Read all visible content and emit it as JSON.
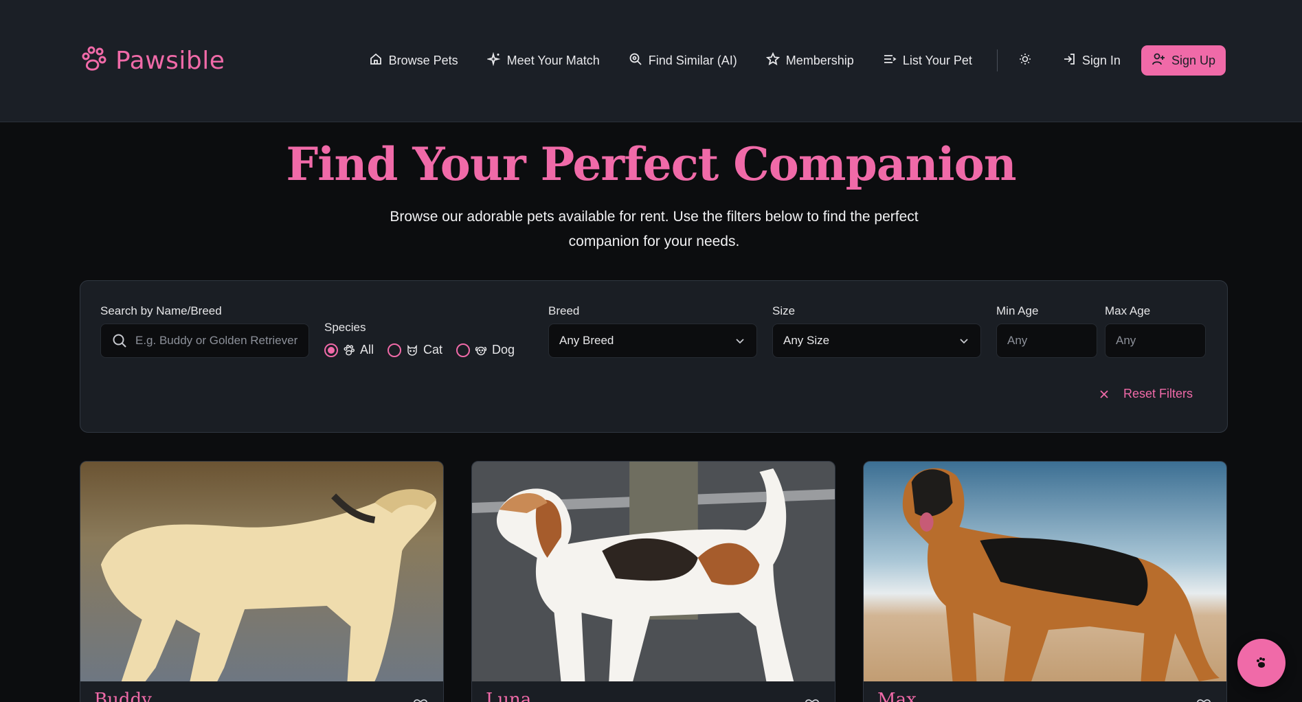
{
  "brand": {
    "name": "Pawsible",
    "color": "#f06aa8"
  },
  "nav": {
    "items": [
      {
        "label": "Browse Pets",
        "icon": "home-icon"
      },
      {
        "label": "Meet Your Match",
        "icon": "sparkles-icon"
      },
      {
        "label": "Find Similar (AI)",
        "icon": "search-zoom-icon"
      },
      {
        "label": "Membership",
        "icon": "star-icon"
      },
      {
        "label": "List Your Pet",
        "icon": "list-icon"
      }
    ],
    "theme_icon": "sun-icon",
    "sign_in": "Sign In",
    "sign_up": "Sign Up"
  },
  "hero": {
    "title": "Find Your Perfect Companion",
    "subtitle": "Browse our adorable pets available for rent. Use the filters below to find the perfect companion for your needs."
  },
  "filters": {
    "search_label": "Search by Name/Breed",
    "search_placeholder": "E.g. Buddy or Golden Retriever",
    "species_label": "Species",
    "species_options": [
      "All",
      "Cat",
      "Dog"
    ],
    "species_selected": "All",
    "breed_label": "Breed",
    "breed_value": "Any Breed",
    "size_label": "Size",
    "size_value": "Any Size",
    "min_age_label": "Min Age",
    "min_age_placeholder": "Any",
    "max_age_label": "Max Age",
    "max_age_placeholder": "Any",
    "reset_label": "Reset Filters"
  },
  "pets": [
    {
      "name": "Buddy",
      "image": "golden-retriever-photo"
    },
    {
      "name": "Luna",
      "image": "beagle-photo"
    },
    {
      "name": "Max",
      "image": "german-shepherd-photo"
    }
  ]
}
